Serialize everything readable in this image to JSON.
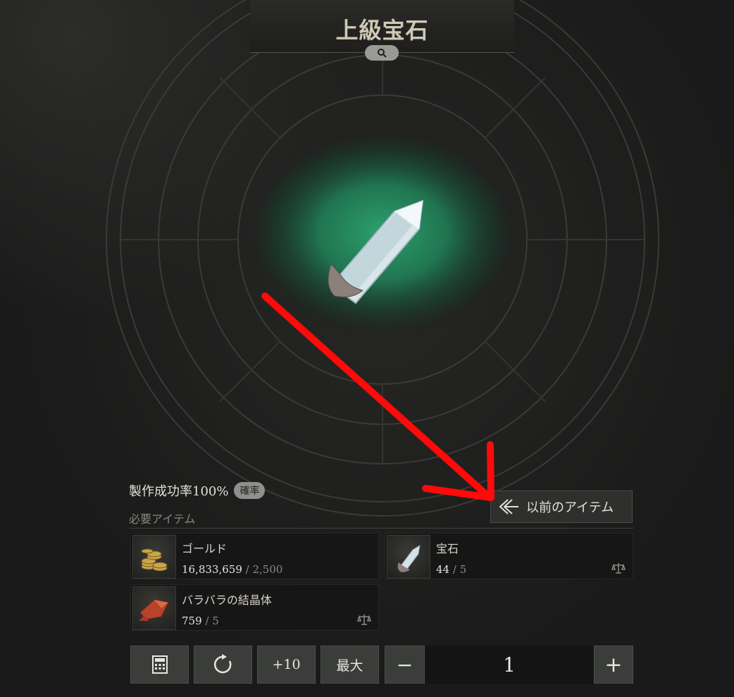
{
  "header": {
    "title": "上級宝石",
    "search_icon": "search-icon"
  },
  "craft": {
    "success_text": "製作成功率100%",
    "badge": "確率"
  },
  "required_label": "必要アイテム",
  "previous_button": {
    "label": "以前のアイテム",
    "icon": "arrow-left-icon"
  },
  "materials": [
    {
      "name": "ゴールド",
      "have": "16,833,659",
      "need": "2,500",
      "icon": "gold-coins-icon"
    },
    {
      "name": "宝石",
      "have": "44",
      "need": "5",
      "icon": "gem-icon"
    },
    {
      "name": "バラバラの結晶体",
      "have": "759",
      "need": "5",
      "icon": "red-crystal-icon"
    }
  ],
  "controls": {
    "calculator_icon": "calculator-icon",
    "reset_icon": "refresh-icon",
    "plus10_label": "+10",
    "max_label": "最大",
    "minus_label": "−",
    "quantity": "1",
    "plus_label": "+"
  },
  "annotation": {
    "color": "#ff0a0a"
  },
  "colors": {
    "glow": "#1f8a5c",
    "background": "#1c1c1c"
  }
}
